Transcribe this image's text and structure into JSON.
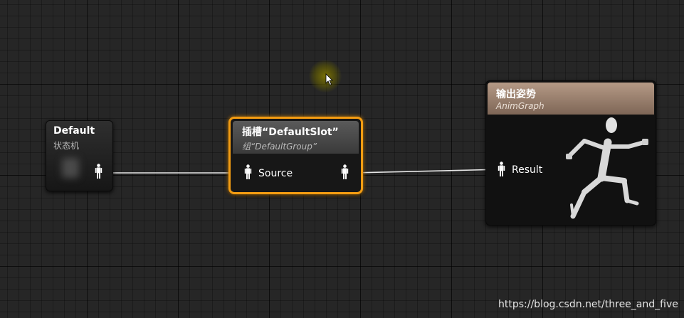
{
  "graph": {
    "nodes": {
      "default": {
        "title": "Default",
        "subtitle": "状态机"
      },
      "slot": {
        "title": "插槽“DefaultSlot”",
        "subtitle": "组“DefaultGroup”",
        "input_pin": "Source"
      },
      "output": {
        "title": "输出姿势",
        "subtitle": "AnimGraph",
        "input_pin": "Result"
      }
    },
    "colors": {
      "wire": "#e6e6e6",
      "selected_border": "#f39c12",
      "output_header": "#9e8573"
    }
  },
  "watermark": "https://blog.csdn.net/three_and_five"
}
